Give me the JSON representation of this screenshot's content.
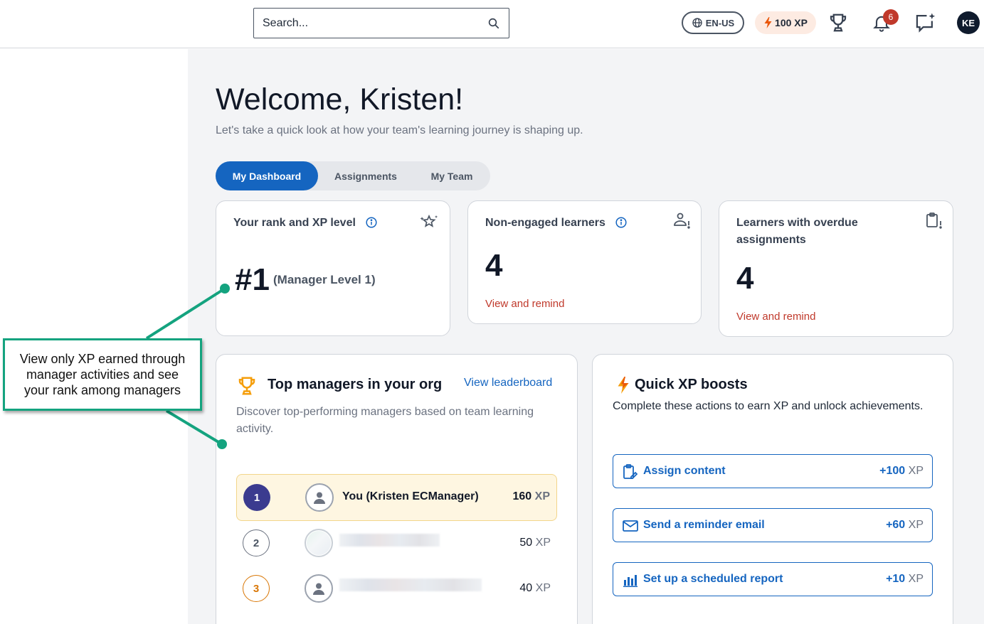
{
  "header": {
    "search_placeholder": "Search...",
    "language": "EN-US",
    "xp_label": "100 XP",
    "notification_count": "6",
    "avatar_initials": "KE"
  },
  "welcome": {
    "title": "Welcome, Kristen!",
    "subtitle": "Let's take a quick look at how your team's learning journey is shaping up."
  },
  "tabs": [
    {
      "label": "My Dashboard",
      "active": true
    },
    {
      "label": "Assignments",
      "active": false
    },
    {
      "label": "My Team",
      "active": false
    }
  ],
  "cards": {
    "rank": {
      "title": "Your rank and XP level",
      "value": "#1",
      "level": "(Manager Level 1)"
    },
    "non_engaged": {
      "title": "Non-engaged learners",
      "value": "4",
      "link": "View and remind"
    },
    "overdue": {
      "title_line1": "Learners with overdue",
      "title_line2": "assignments",
      "value": "4",
      "link": "View and remind"
    }
  },
  "annotation": {
    "text": "View only XP earned through manager activities and see your rank among managers",
    "color": "#14a37f"
  },
  "leaderboard": {
    "title": "Top managers in your org",
    "link": "View leaderboard",
    "description": "Discover top-performing managers based on team learning activity.",
    "rows": [
      {
        "rank": "1",
        "name": "You (Kristen ECManager)",
        "xp": "160",
        "unit": "XP"
      },
      {
        "rank": "2",
        "name": "",
        "xp": "50",
        "unit": "XP"
      },
      {
        "rank": "3",
        "name": "",
        "xp": "40",
        "unit": "XP"
      }
    ]
  },
  "boosts": {
    "title": "Quick XP boosts",
    "description": "Complete these actions to earn XP and unlock achievements.",
    "items": [
      {
        "icon": "clipboard-edit-icon",
        "label": "Assign content",
        "xp": "+100",
        "unit": "XP"
      },
      {
        "icon": "mail-icon",
        "label": "Send a reminder email",
        "xp": "+60",
        "unit": "XP"
      },
      {
        "icon": "bar-chart-icon",
        "label": "Set up a scheduled report",
        "xp": "+10",
        "unit": "XP"
      }
    ]
  },
  "colors": {
    "primary": "#1565c0",
    "danger": "#c0392b",
    "highlight_row": "#fef6e1",
    "rank1": "#3b3b8f",
    "rank3": "#d97706",
    "trophy": "#f59e0b"
  }
}
